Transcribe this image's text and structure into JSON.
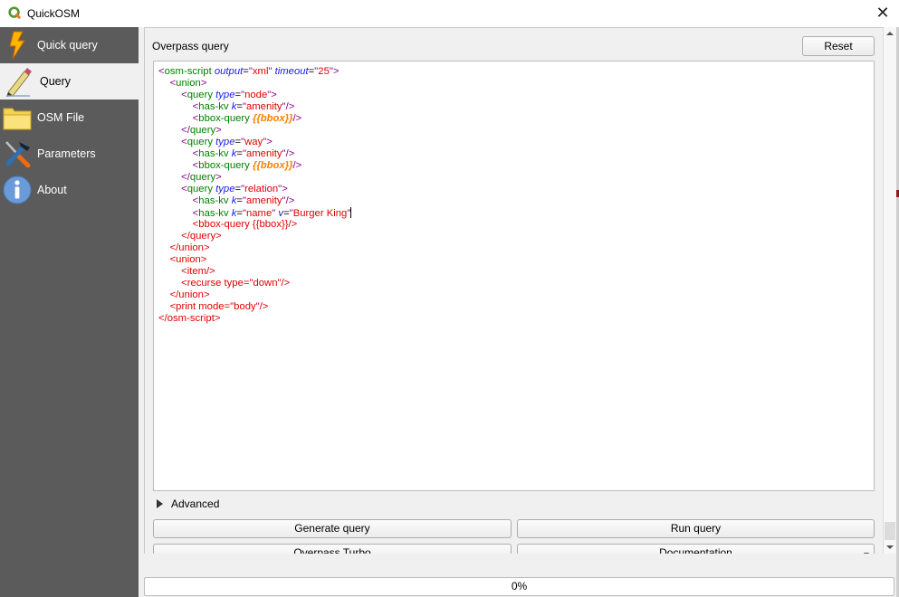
{
  "window": {
    "title": "QuickOSM",
    "close_icon": "close-icon"
  },
  "sidebar": {
    "items": [
      {
        "label": "Quick query",
        "icon": "lightning-icon",
        "active": false
      },
      {
        "label": "Query",
        "icon": "pencil-icon",
        "active": true
      },
      {
        "label": "OSM File",
        "icon": "folder-icon",
        "active": false
      },
      {
        "label": "Parameters",
        "icon": "tools-icon",
        "active": false
      },
      {
        "label": "About",
        "icon": "info-icon",
        "active": false
      }
    ]
  },
  "main": {
    "section_label": "Overpass query",
    "reset_label": "Reset",
    "query_text": "<osm-script output=\"xml\" timeout=\"25\">\n  <union>\n    <query type=\"node\">\n      <has-kv k=\"amenity\"/>\n      <bbox-query {{bbox}}/>\n    </query>\n    <query type=\"way\">\n      <has-kv k=\"amenity\"/>\n      <bbox-query {{bbox}}/>\n    </query>\n    <query type=\"relation\">\n      <has-kv k=\"amenity\"/>\n      <has-kv k=\"name\" v=\"Burger King\"\n      <bbox-query {{bbox}}/>\n    </query>\n  </union>\n  <union>\n    <item/>\n    <recurse type=\"down\"/>\n  </union>\n  <print mode=\"body\"/>\n</osm-script>",
    "advanced_label": "Advanced",
    "generate_label": "Generate query",
    "run_label": "Run query",
    "overpass_turbo_label": "Overpass Turbo",
    "documentation_label": "Documentation",
    "progress_text": "0%",
    "progress_value": 0
  },
  "colors": {
    "sidebar_bg": "#5b5b5b",
    "tag": "#008000",
    "bracket": "#8b008b",
    "attribute": "#1a1ae6",
    "value": "#e00000",
    "bbox_placeholder": "#ff8000"
  }
}
